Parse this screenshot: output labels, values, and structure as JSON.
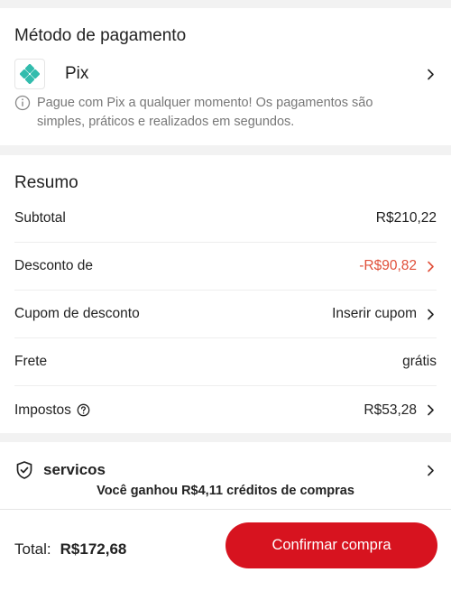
{
  "payment": {
    "title": "Método de pagamento",
    "method_name": "Pix",
    "info": "Pague com Pix a qualquer momento! Os pagamentos são simples, práticos e realizados em segundos."
  },
  "summary": {
    "title": "Resumo",
    "rows": [
      {
        "label": "Subtotal",
        "value": "R$210,22"
      },
      {
        "label": "Desconto de",
        "value": "-R$90,82"
      },
      {
        "label": "Cupom de desconto",
        "value": "Inserir cupom"
      },
      {
        "label": "Frete",
        "value": "grátis"
      },
      {
        "label": "Impostos",
        "value": "R$53,28"
      }
    ]
  },
  "services": {
    "label": "servicos",
    "credits": "Você ganhou R$4,11 créditos de compras"
  },
  "footer": {
    "total_label": "Total:",
    "total_value": "R$172,68",
    "confirm_label": "Confirmar compra"
  },
  "colors": {
    "accent": "#d7131f",
    "discount": "#e0503a",
    "pix": "#32bcad"
  }
}
